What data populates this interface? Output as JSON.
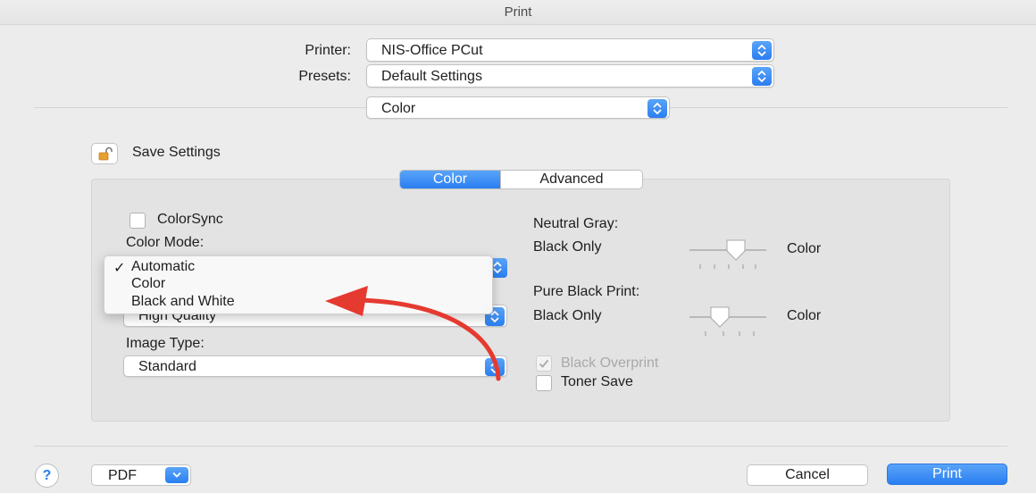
{
  "window": {
    "title": "Print"
  },
  "printer": {
    "label": "Printer:",
    "value": "NIS-Office PCut"
  },
  "presets": {
    "label": "Presets:",
    "value": "Default Settings"
  },
  "section": {
    "value": "Color"
  },
  "save_settings": {
    "label": "Save Settings",
    "icon": "lock-open-icon"
  },
  "tabs": [
    {
      "label": "Color",
      "selected": true
    },
    {
      "label": "Advanced",
      "selected": false
    }
  ],
  "left": {
    "colorsync": {
      "label": "ColorSync",
      "checked": false
    },
    "color_mode": {
      "label": "Color Mode:",
      "menu": [
        {
          "label": "Automatic",
          "checked": true
        },
        {
          "label": "Color",
          "checked": false
        },
        {
          "label": "Black and White",
          "checked": false
        }
      ],
      "checkmark": "✓"
    },
    "quality": {
      "value": "High Quality"
    },
    "image_type": {
      "label": "Image Type:",
      "value": "Standard"
    }
  },
  "right": {
    "neutral_gray": {
      "label": "Neutral Gray:",
      "left": "Black Only",
      "right": "Color",
      "level": 0.6
    },
    "pure_black": {
      "label": "Pure Black Print:",
      "left": "Black Only",
      "right": "Color",
      "level": 0.4
    },
    "black_overprint": {
      "label": "Black Overprint",
      "checked": true,
      "enabled": false
    },
    "toner_save": {
      "label": "Toner Save",
      "checked": false
    }
  },
  "footer": {
    "help": "?",
    "pdf": "PDF",
    "cancel": "Cancel",
    "print": "Print"
  },
  "colors": {
    "accent": "#2a7ef1",
    "annotation_arrow": "#e53a2f"
  }
}
